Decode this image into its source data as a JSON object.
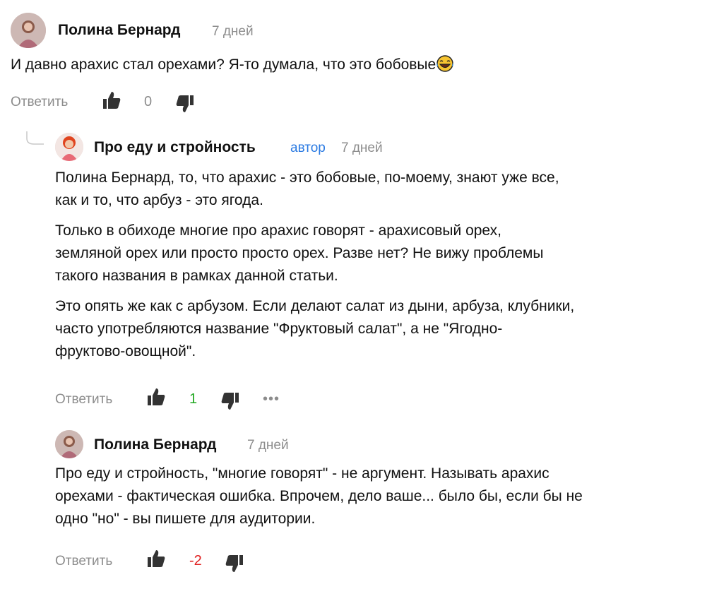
{
  "colors": {
    "text": "#111111",
    "muted": "#8c8c8c",
    "author_badge": "#2a7ae2",
    "positive": "#22a822",
    "negative": "#e02020",
    "icon": "#333333"
  },
  "comments": [
    {
      "author": "Полина Бернард",
      "time": "7 дней",
      "text": [
        "И давно арахис стал орехами? Я-то думала, что это бобовые"
      ],
      "emoji": "tears-of-joy-emoji",
      "reply_label": "Ответить",
      "likes": "0"
    },
    {
      "author": "Про еду и стройность",
      "badge": "автор",
      "time": "7 дней",
      "paragraphs": [
        [
          "Полина Бернард, то, что арахис - это бобовые, по-моему, знают уже все,",
          "как и то, что арбуз - это ягода."
        ],
        [
          "Только в обиходе многие про арахис говорят - арахисовый орех,",
          "земляной орех или просто просто орех. Разве нет? Не вижу проблемы",
          "такого названия в рамках данной статьи."
        ],
        [
          "Это опять же как с арбузом. Если делают салат из дыни, арбуза, клубники,",
          "часто употребляются название \"Фруктовый салат\", а не \"Ягодно-",
          "фруктово-овощной\"."
        ]
      ],
      "reply_label": "Ответить",
      "likes": "1",
      "more": "•••"
    },
    {
      "author": "Полина Бернард",
      "time": "7 дней",
      "text": [
        "Про еду и стройность, \"многие говорят\" - не аргумент. Называть арахис",
        "орехами - фактическая ошибка. Впрочем, дело ваше... было бы, если бы не",
        "одно \"но\" - вы пишете для аудитории."
      ],
      "reply_label": "Ответить",
      "likes": "-2"
    }
  ]
}
